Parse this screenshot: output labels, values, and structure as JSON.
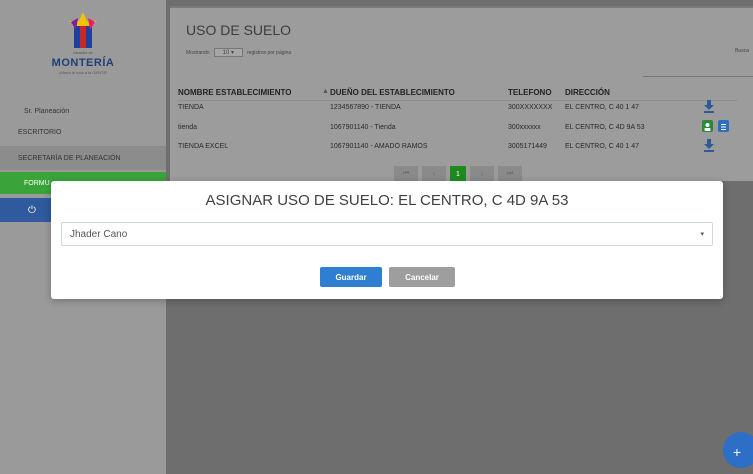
{
  "sidebar": {
    "logo_pre": "Alcaldía de",
    "logo_text": "MONTERÍA",
    "logo_sub": "¡Ahora le toca a la GENTE!",
    "user": "Sr. Planeación",
    "items": [
      {
        "label": "ESCRITORIO"
      },
      {
        "label": "SECRETARÍA DE PLANEACIÓN"
      },
      {
        "label": "FORMU"
      }
    ],
    "power_glyph": "⏻"
  },
  "panel": {
    "title": "USO DE SUELO",
    "showing_prefix": "Mostrando",
    "showing_value": "10",
    "showing_suffix": "registros por página",
    "search_label": "Busca",
    "columns": [
      "NOMBRE ESTABLECIMIENTO",
      "DUEÑO DEL ESTABLECIMIENTO",
      "TELEFONO",
      "DIRECCIÓN"
    ],
    "rows": [
      {
        "nombre": "TIENDA",
        "dueno": "1234567890 - TIENDA",
        "telefono": "300XXXXXXX",
        "direccion": "EL CENTRO, C 40 1 47"
      },
      {
        "nombre": "tienda",
        "dueno": "1067901140 - Tienda",
        "telefono": "300xxxxxx",
        "direccion": "EL CENTRO, C 4D 9A 53"
      },
      {
        "nombre": "TIENDA EXCEL",
        "dueno": "1067901140 - AMADO RAMOS",
        "telefono": "3005171449",
        "direccion": "EL CENTRO, C 40 1 47"
      }
    ],
    "pager": {
      "first": "⏮",
      "prev": "‹",
      "current": "1",
      "next": "›",
      "last": "⏭"
    }
  },
  "modal": {
    "title": "ASIGNAR USO DE SUELO: EL CENTRO, C 4D 9A 53",
    "selected": "Jhader Cano",
    "save_label": "Guardar",
    "cancel_label": "Cancelar"
  },
  "fab_label": "+",
  "colors": {
    "accent_blue": "#2e7fd1",
    "accent_green": "#3aa43a",
    "sidebar_power": "#2f5a9e"
  }
}
